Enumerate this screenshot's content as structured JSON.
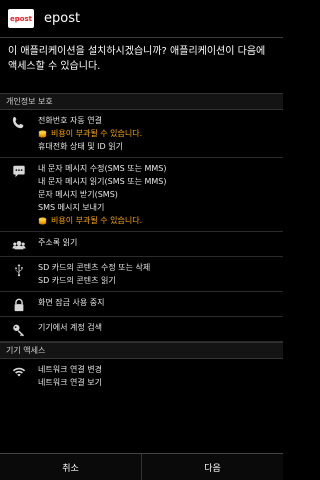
{
  "app": {
    "title": "epost",
    "icon_text": "epost"
  },
  "prompt": "이 애플리케이션을 설치하시겠습니까? 애플리케이션이 다음에 액세스할 수 있습니다.",
  "sections": [
    {
      "title": "개인정보 보호",
      "groups": [
        {
          "icon": "phone-icon",
          "lines": [
            {
              "text": "전화번호 자동 연결",
              "type": "normal"
            },
            {
              "text": "비용이 부과될 수 있습니다.",
              "type": "cost"
            },
            {
              "text": "휴대전화 상태 및 ID 읽기",
              "type": "normal"
            }
          ]
        },
        {
          "icon": "message-icon",
          "lines": [
            {
              "text": "내 문자 메시지 수정(SMS 또는 MMS)",
              "type": "normal"
            },
            {
              "text": "내 문자 메시지 읽기(SMS 또는 MMS)",
              "type": "normal"
            },
            {
              "text": "문자 메시지 받기(SMS)",
              "type": "normal"
            },
            {
              "text": "SMS 메시지 보내기",
              "type": "normal"
            },
            {
              "text": "비용이 부과될 수 있습니다.",
              "type": "cost"
            }
          ]
        },
        {
          "icon": "contacts-icon",
          "lines": [
            {
              "text": "주소록 읽기",
              "type": "normal"
            }
          ]
        },
        {
          "icon": "usb-icon",
          "lines": [
            {
              "text": "SD 카드의 콘텐츠 수정 또는 삭제",
              "type": "normal"
            },
            {
              "text": "SD 카드의 콘텐츠 읽기",
              "type": "normal"
            }
          ]
        },
        {
          "icon": "lock-icon",
          "lines": [
            {
              "text": "화면 잠금 사용 중지",
              "type": "normal"
            }
          ]
        },
        {
          "icon": "key-icon",
          "lines": [
            {
              "text": "기기에서 계정 검색",
              "type": "normal"
            }
          ]
        }
      ]
    },
    {
      "title": "기기 액세스",
      "groups": [
        {
          "icon": "wifi-icon",
          "lines": [
            {
              "text": "네트워크 연결 변경",
              "type": "normal"
            },
            {
              "text": "네트워크 연결 보기",
              "type": "normal"
            }
          ]
        }
      ]
    }
  ],
  "buttons": {
    "cancel": "취소",
    "next": "다음"
  },
  "colors": {
    "cost_text": "#ffa800",
    "background": "#000000"
  }
}
